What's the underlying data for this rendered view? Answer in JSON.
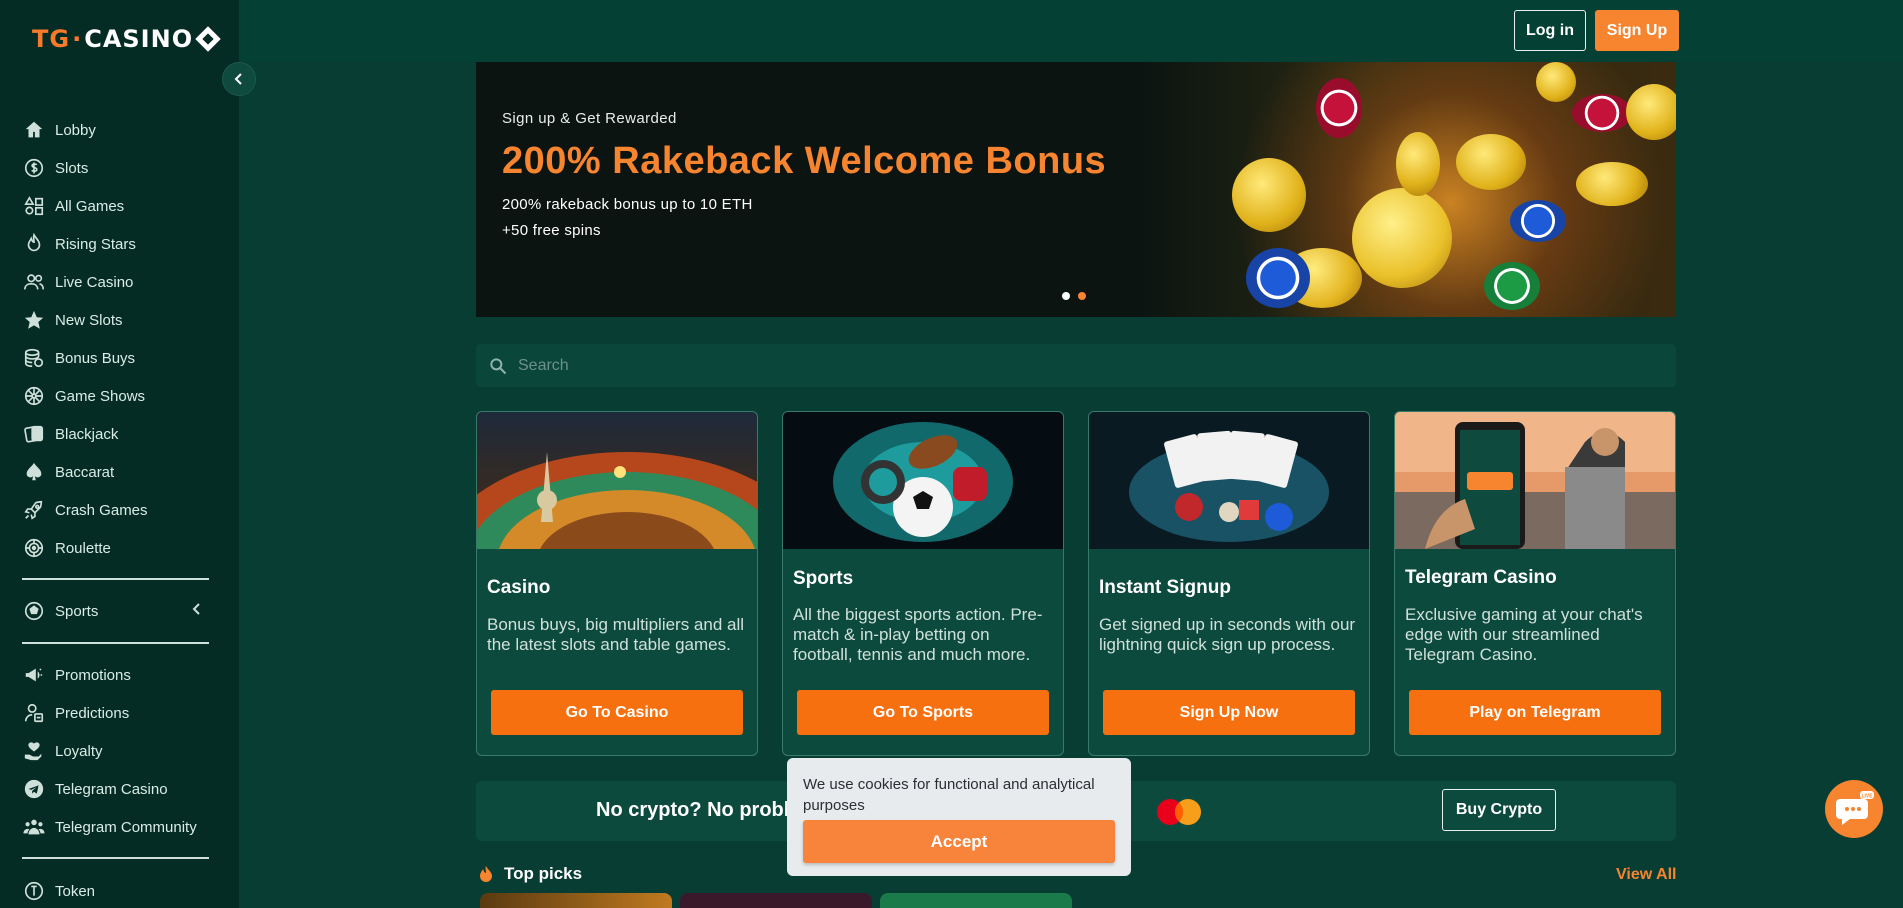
{
  "brand": {
    "logo_prefix": "TG",
    "logo_dot": "·",
    "logo_text": "CASINO",
    "accent": "#f7842f"
  },
  "header": {
    "login_label": "Log in",
    "signup_label": "Sign Up"
  },
  "sidebar": {
    "items": [
      {
        "label": "Lobby",
        "icon": "home-icon"
      },
      {
        "label": "Slots",
        "icon": "dollar-coin-icon"
      },
      {
        "label": "All Games",
        "icon": "shapes-icon"
      },
      {
        "label": "Rising Stars",
        "icon": "flame-icon"
      },
      {
        "label": "Live Casino",
        "icon": "users-icon"
      },
      {
        "label": "New Slots",
        "icon": "star-icon"
      },
      {
        "label": "Bonus Buys",
        "icon": "coin-stack-icon"
      },
      {
        "label": "Game Shows",
        "icon": "wheel-icon"
      },
      {
        "label": "Blackjack",
        "icon": "cards-icon"
      },
      {
        "label": "Baccarat",
        "icon": "spade-icon"
      },
      {
        "label": "Crash Games",
        "icon": "rocket-icon"
      },
      {
        "label": "Roulette",
        "icon": "roulette-icon"
      }
    ],
    "sports": {
      "label": "Sports",
      "icon": "soccer-ball-icon"
    },
    "items2": [
      {
        "label": "Promotions",
        "icon": "megaphone-icon"
      },
      {
        "label": "Predictions",
        "icon": "predictions-icon"
      },
      {
        "label": "Loyalty",
        "icon": "heart-hand-icon"
      },
      {
        "label": "Telegram Casino",
        "icon": "telegram-icon"
      },
      {
        "label": "Telegram Community",
        "icon": "community-icon"
      }
    ],
    "token": {
      "label": "Token",
      "icon": "token-icon"
    }
  },
  "banner": {
    "kicker": "Sign up & Get Rewarded",
    "title": "200% Rakeback Welcome Bonus",
    "line1": "200% rakeback bonus up to 10 ETH",
    "line2": "+50 free spins"
  },
  "search": {
    "placeholder": "Search"
  },
  "cards": [
    {
      "title": "Casino",
      "desc": "Bonus buys, big multipliers and all the latest slots and table games.",
      "button": "Go To Casino"
    },
    {
      "title": "Sports",
      "desc": "All the biggest sports action. Pre-match & in-play betting on football, tennis and much more.",
      "button": "Go To Sports"
    },
    {
      "title": "Instant Signup",
      "desc": "Get signed up in seconds with our lightning quick sign up process.",
      "button": "Sign Up Now"
    },
    {
      "title": "Telegram Casino",
      "desc": "Exclusive gaming at your chat's edge with our streamlined Telegram Casino.",
      "button": "Play on Telegram"
    }
  ],
  "crypto": {
    "text": "No crypto? No proble",
    "button": "Buy Crypto"
  },
  "cookie": {
    "text": "We use cookies for functional and analytical purposes",
    "button": "Accept"
  },
  "top_picks": {
    "label": "Top picks",
    "view_all": "View All"
  },
  "live_chat": {
    "badge": "LIVE"
  }
}
